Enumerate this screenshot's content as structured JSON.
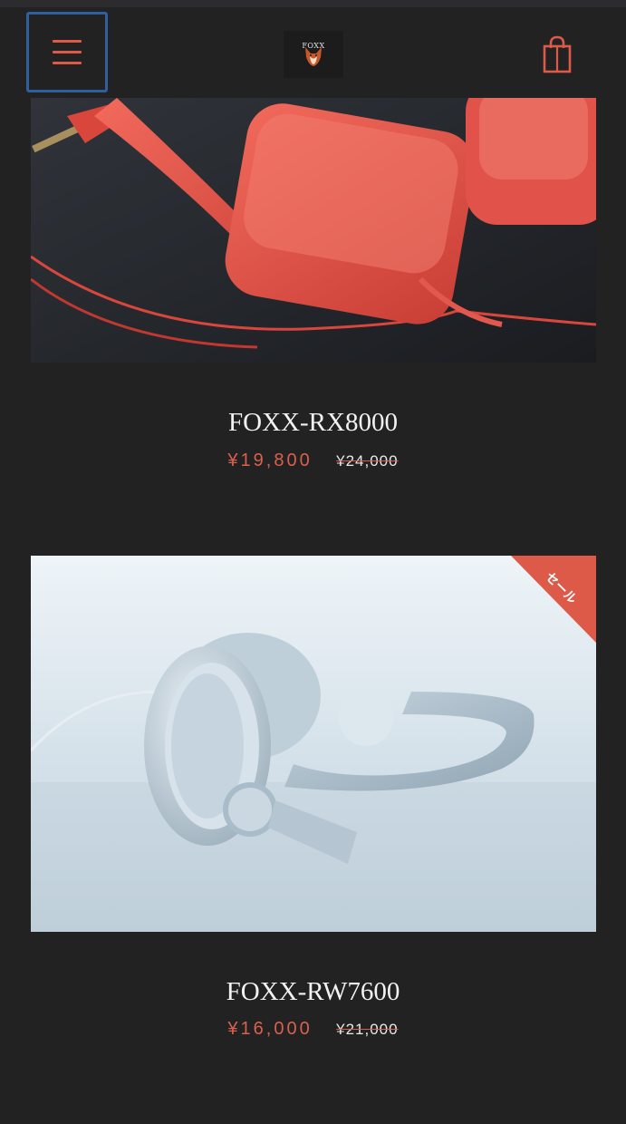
{
  "header": {
    "menu_icon": "hamburger-menu-icon",
    "logo_text": "FOXX",
    "cart_icon": "shopping-bag-icon",
    "accent_color": "#dc5a48"
  },
  "products": [
    {
      "name": "FOXX-RX8000",
      "sale_price": "¥19,800",
      "original_price": "¥24,000",
      "image": "red-headphones-photo"
    },
    {
      "name": "FOXX-RW7600",
      "sale_price": "¥16,000",
      "original_price": "¥21,000",
      "image": "white-headphones-photo",
      "badge": "セール"
    }
  ]
}
